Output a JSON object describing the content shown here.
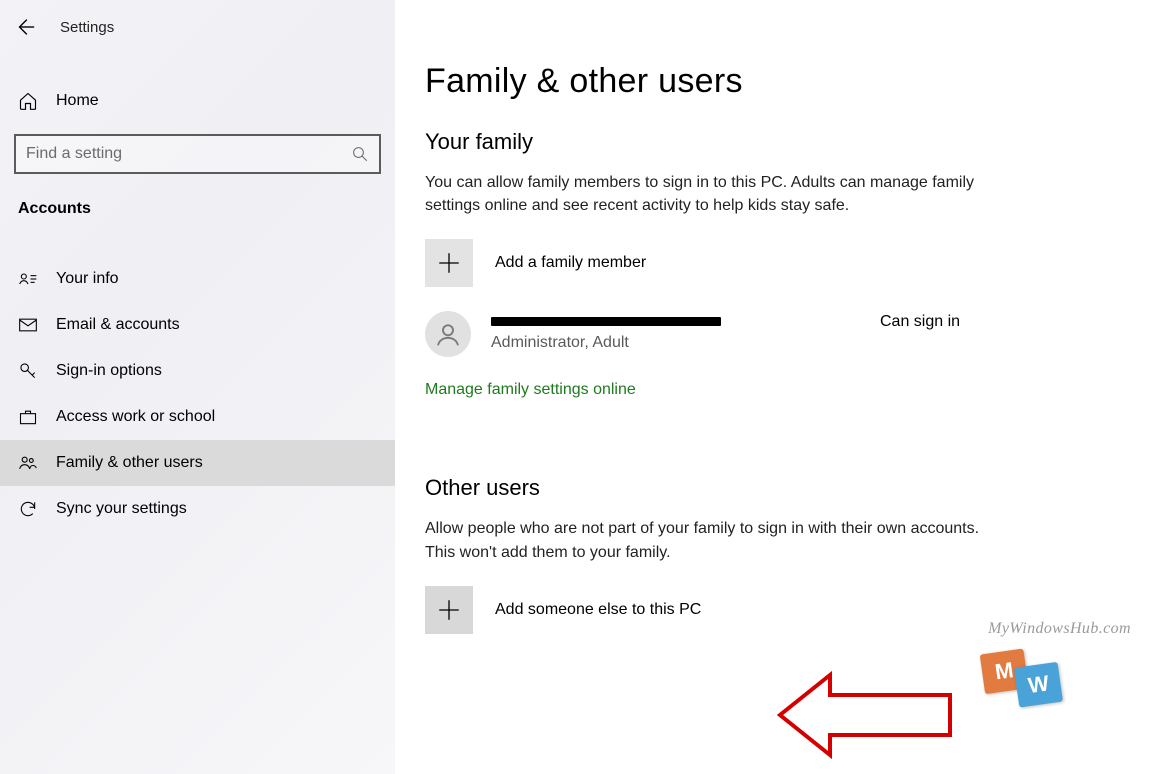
{
  "header": {
    "app_title": "Settings"
  },
  "sidebar": {
    "home_label": "Home",
    "search_placeholder": "Find a setting",
    "section_label": "Accounts",
    "items": [
      {
        "label": "Your info"
      },
      {
        "label": "Email & accounts"
      },
      {
        "label": "Sign-in options"
      },
      {
        "label": "Access work or school"
      },
      {
        "label": "Family & other users"
      },
      {
        "label": "Sync your settings"
      }
    ],
    "selected_index": 4
  },
  "main": {
    "page_title": "Family & other users",
    "family": {
      "heading": "Your family",
      "description": "You can allow family members to sign in to this PC. Adults can manage family settings online and see recent activity to help kids stay safe.",
      "add_label": "Add a family member",
      "member_role": "Administrator, Adult",
      "member_status": "Can sign in",
      "manage_link": "Manage family settings online"
    },
    "other": {
      "heading": "Other users",
      "description": "Allow people who are not part of your family to sign in with their own accounts. This won't add them to your family.",
      "add_label": "Add someone else to this PC"
    }
  },
  "watermark": {
    "text": "MyWindowsHub.com",
    "tile1": "M",
    "tile2": "W"
  },
  "colors": {
    "link_green": "#1e7a1e",
    "arrow_red": "#d40000"
  }
}
